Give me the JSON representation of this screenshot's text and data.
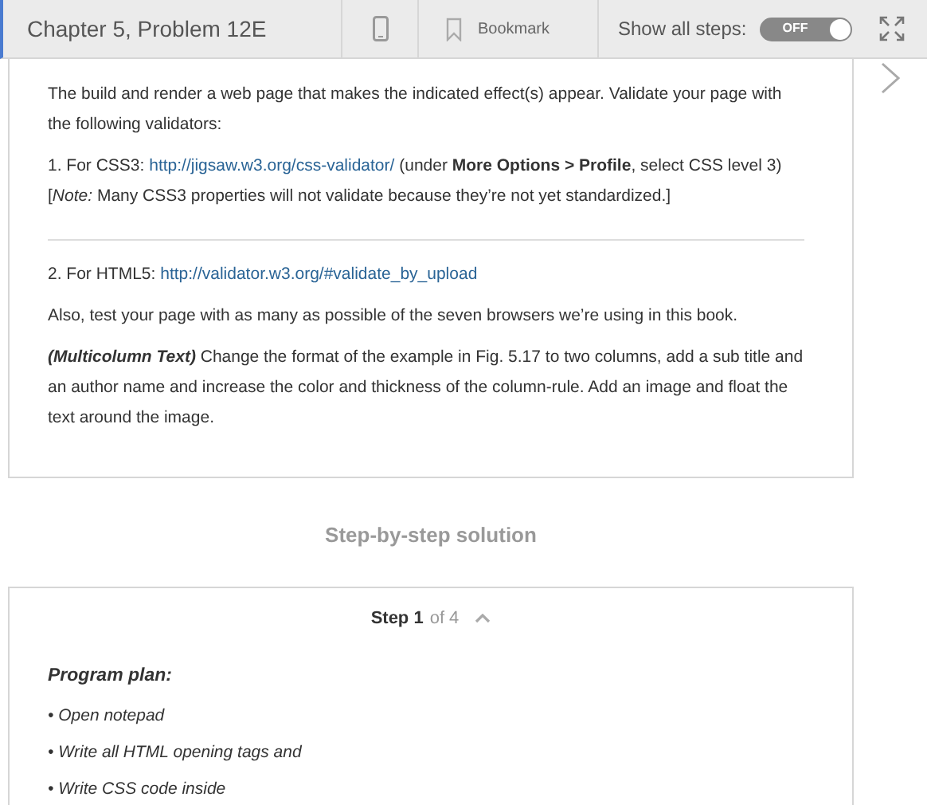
{
  "header": {
    "title": "Chapter 5, Problem 12E",
    "bookmark": "Bookmark",
    "show_all_label": "Show all steps:",
    "toggle": {
      "on": false,
      "label": "OFF"
    }
  },
  "problem": {
    "paragraphs": [
      [
        {
          "kind": "text",
          "text": "The build and render a web page that makes the indicated effect(s) appear. Validate your page with the following validators:"
        }
      ],
      [
        {
          "kind": "text",
          "text": "1. For CSS3: "
        },
        {
          "kind": "link",
          "text": "http://jigsaw.w3.org/css-validator/"
        },
        {
          "kind": "text",
          "text": " (under **More Options > Profile**, select CSS level 3) [*Note:* Many CSS3 properties will not validate because they’re not yet standardized.]"
        }
      ],
      [
        {
          "kind": "rule"
        }
      ],
      [
        {
          "kind": "text",
          "text": "2. For HTML5: "
        },
        {
          "kind": "link",
          "text": "http://validator.w3.org/#validate_by_upload"
        }
      ],
      [
        {
          "kind": "text",
          "text": "Also, test your page with as many as possible of the seven browsers we’re using in this book."
        }
      ],
      [
        {
          "kind": "lead",
          "text": "(Multicolumn Text)"
        },
        {
          "kind": "text",
          "text": " Change the format of the example in Fig. 5.17 to two columns, add a sub title and an author name and increase the color and thickness of the column-rule. Add an image and float the text around the image."
        }
      ]
    ]
  },
  "solution_heading": "Step-by-step solution",
  "step": {
    "label": "Step 1",
    "of": "of 4",
    "expanded": true,
    "heading": "Program plan:",
    "items": [
      "• Open notepad",
      "• Write all HTML opening tags and",
      "• Write CSS code inside"
    ]
  }
}
